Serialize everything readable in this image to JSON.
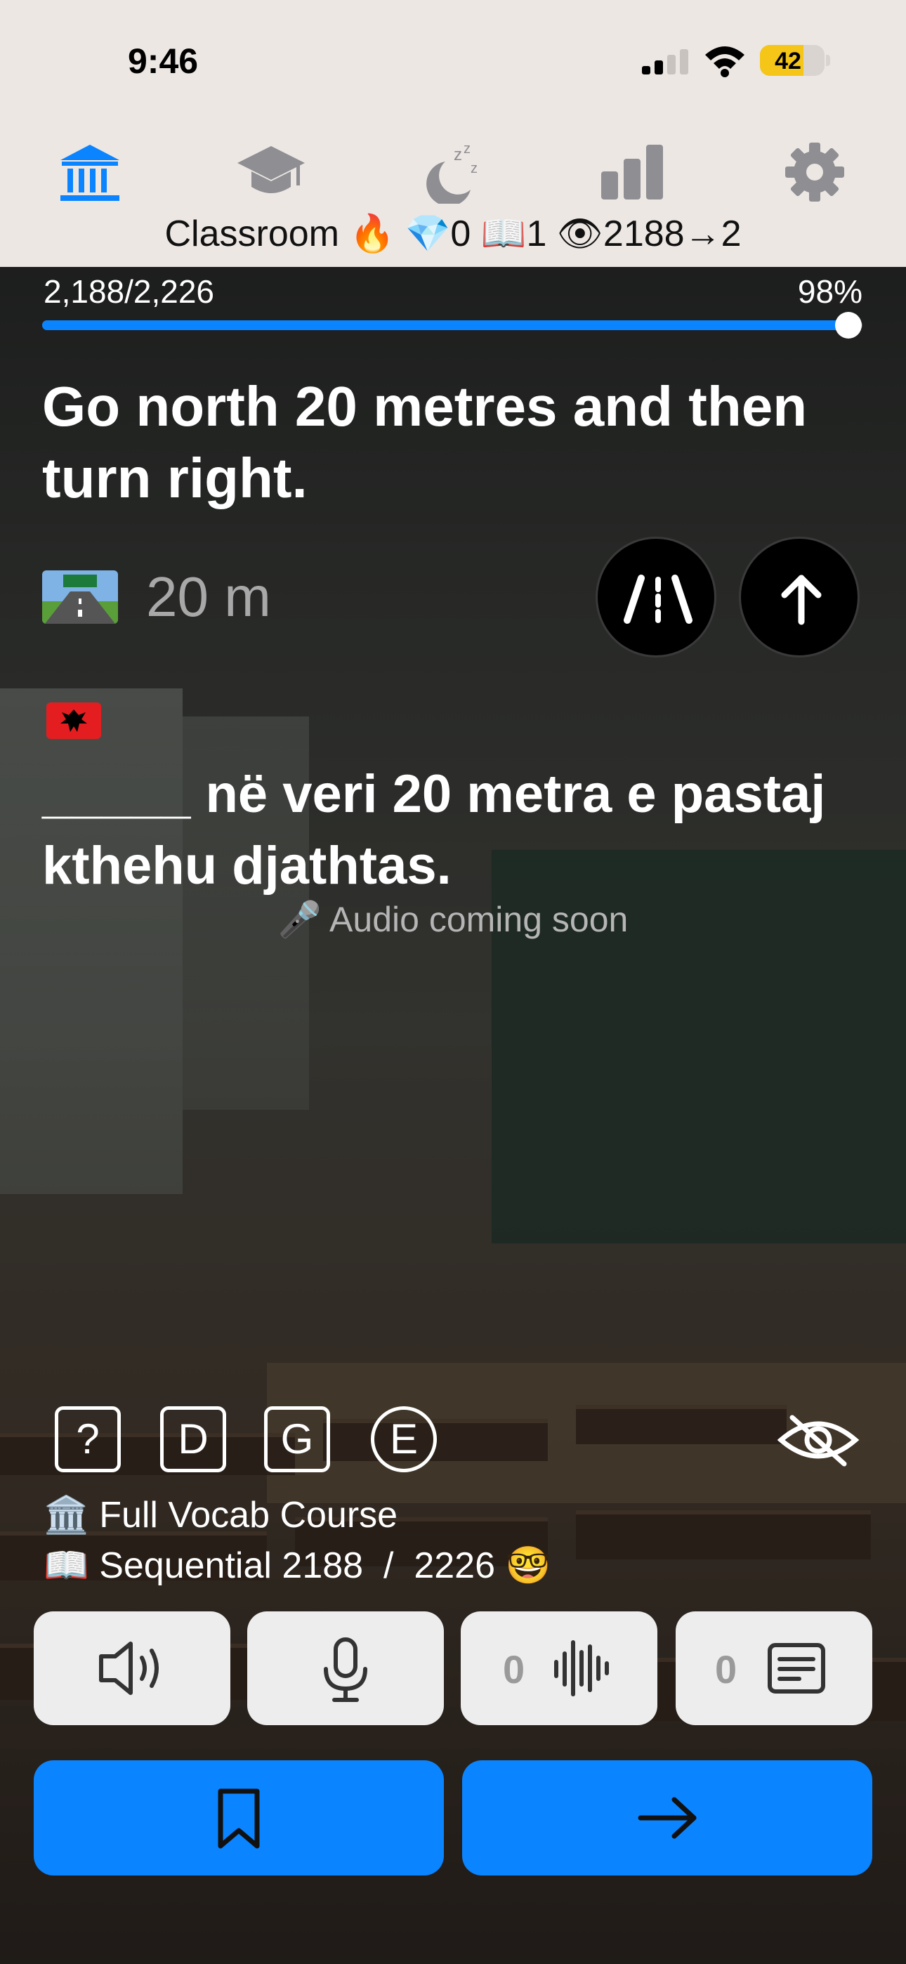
{
  "status_bar": {
    "time": "9:46",
    "battery": "42"
  },
  "nav": {
    "tabs": [
      "classroom-tab",
      "graduation-cap-tab",
      "sleep-tab",
      "stats-tab",
      "settings-tab"
    ],
    "active_color": "#0A84FF",
    "inactive_color": "#8E8E93",
    "title": {
      "name": "Classroom",
      "streak_emoji": "🔥",
      "gem_emoji": "💎",
      "gems": "0",
      "book_emoji": "📖",
      "books": "1",
      "eye_emoji": "👁",
      "views": "2188→2"
    }
  },
  "progress": {
    "count": "2,188/2,226",
    "percent": "98%",
    "fraction": 0.983
  },
  "card": {
    "sentence": "Go north 20 metres and then turn right.",
    "distance": "20 m",
    "target_blank": "_____",
    "target_rest": " në veri 20 metra e pastaj kthehu djathtas.",
    "audio_note": "🎤 Audio coming soon"
  },
  "hints": {
    "question": "?",
    "d": "D",
    "g": "G",
    "e": "E"
  },
  "course": {
    "name": "🏛️ Full Vocab Course",
    "sequential": "📖 Sequential 2188  /  2226 🤓"
  },
  "tools": {
    "recordings": "0",
    "notes": "0"
  }
}
